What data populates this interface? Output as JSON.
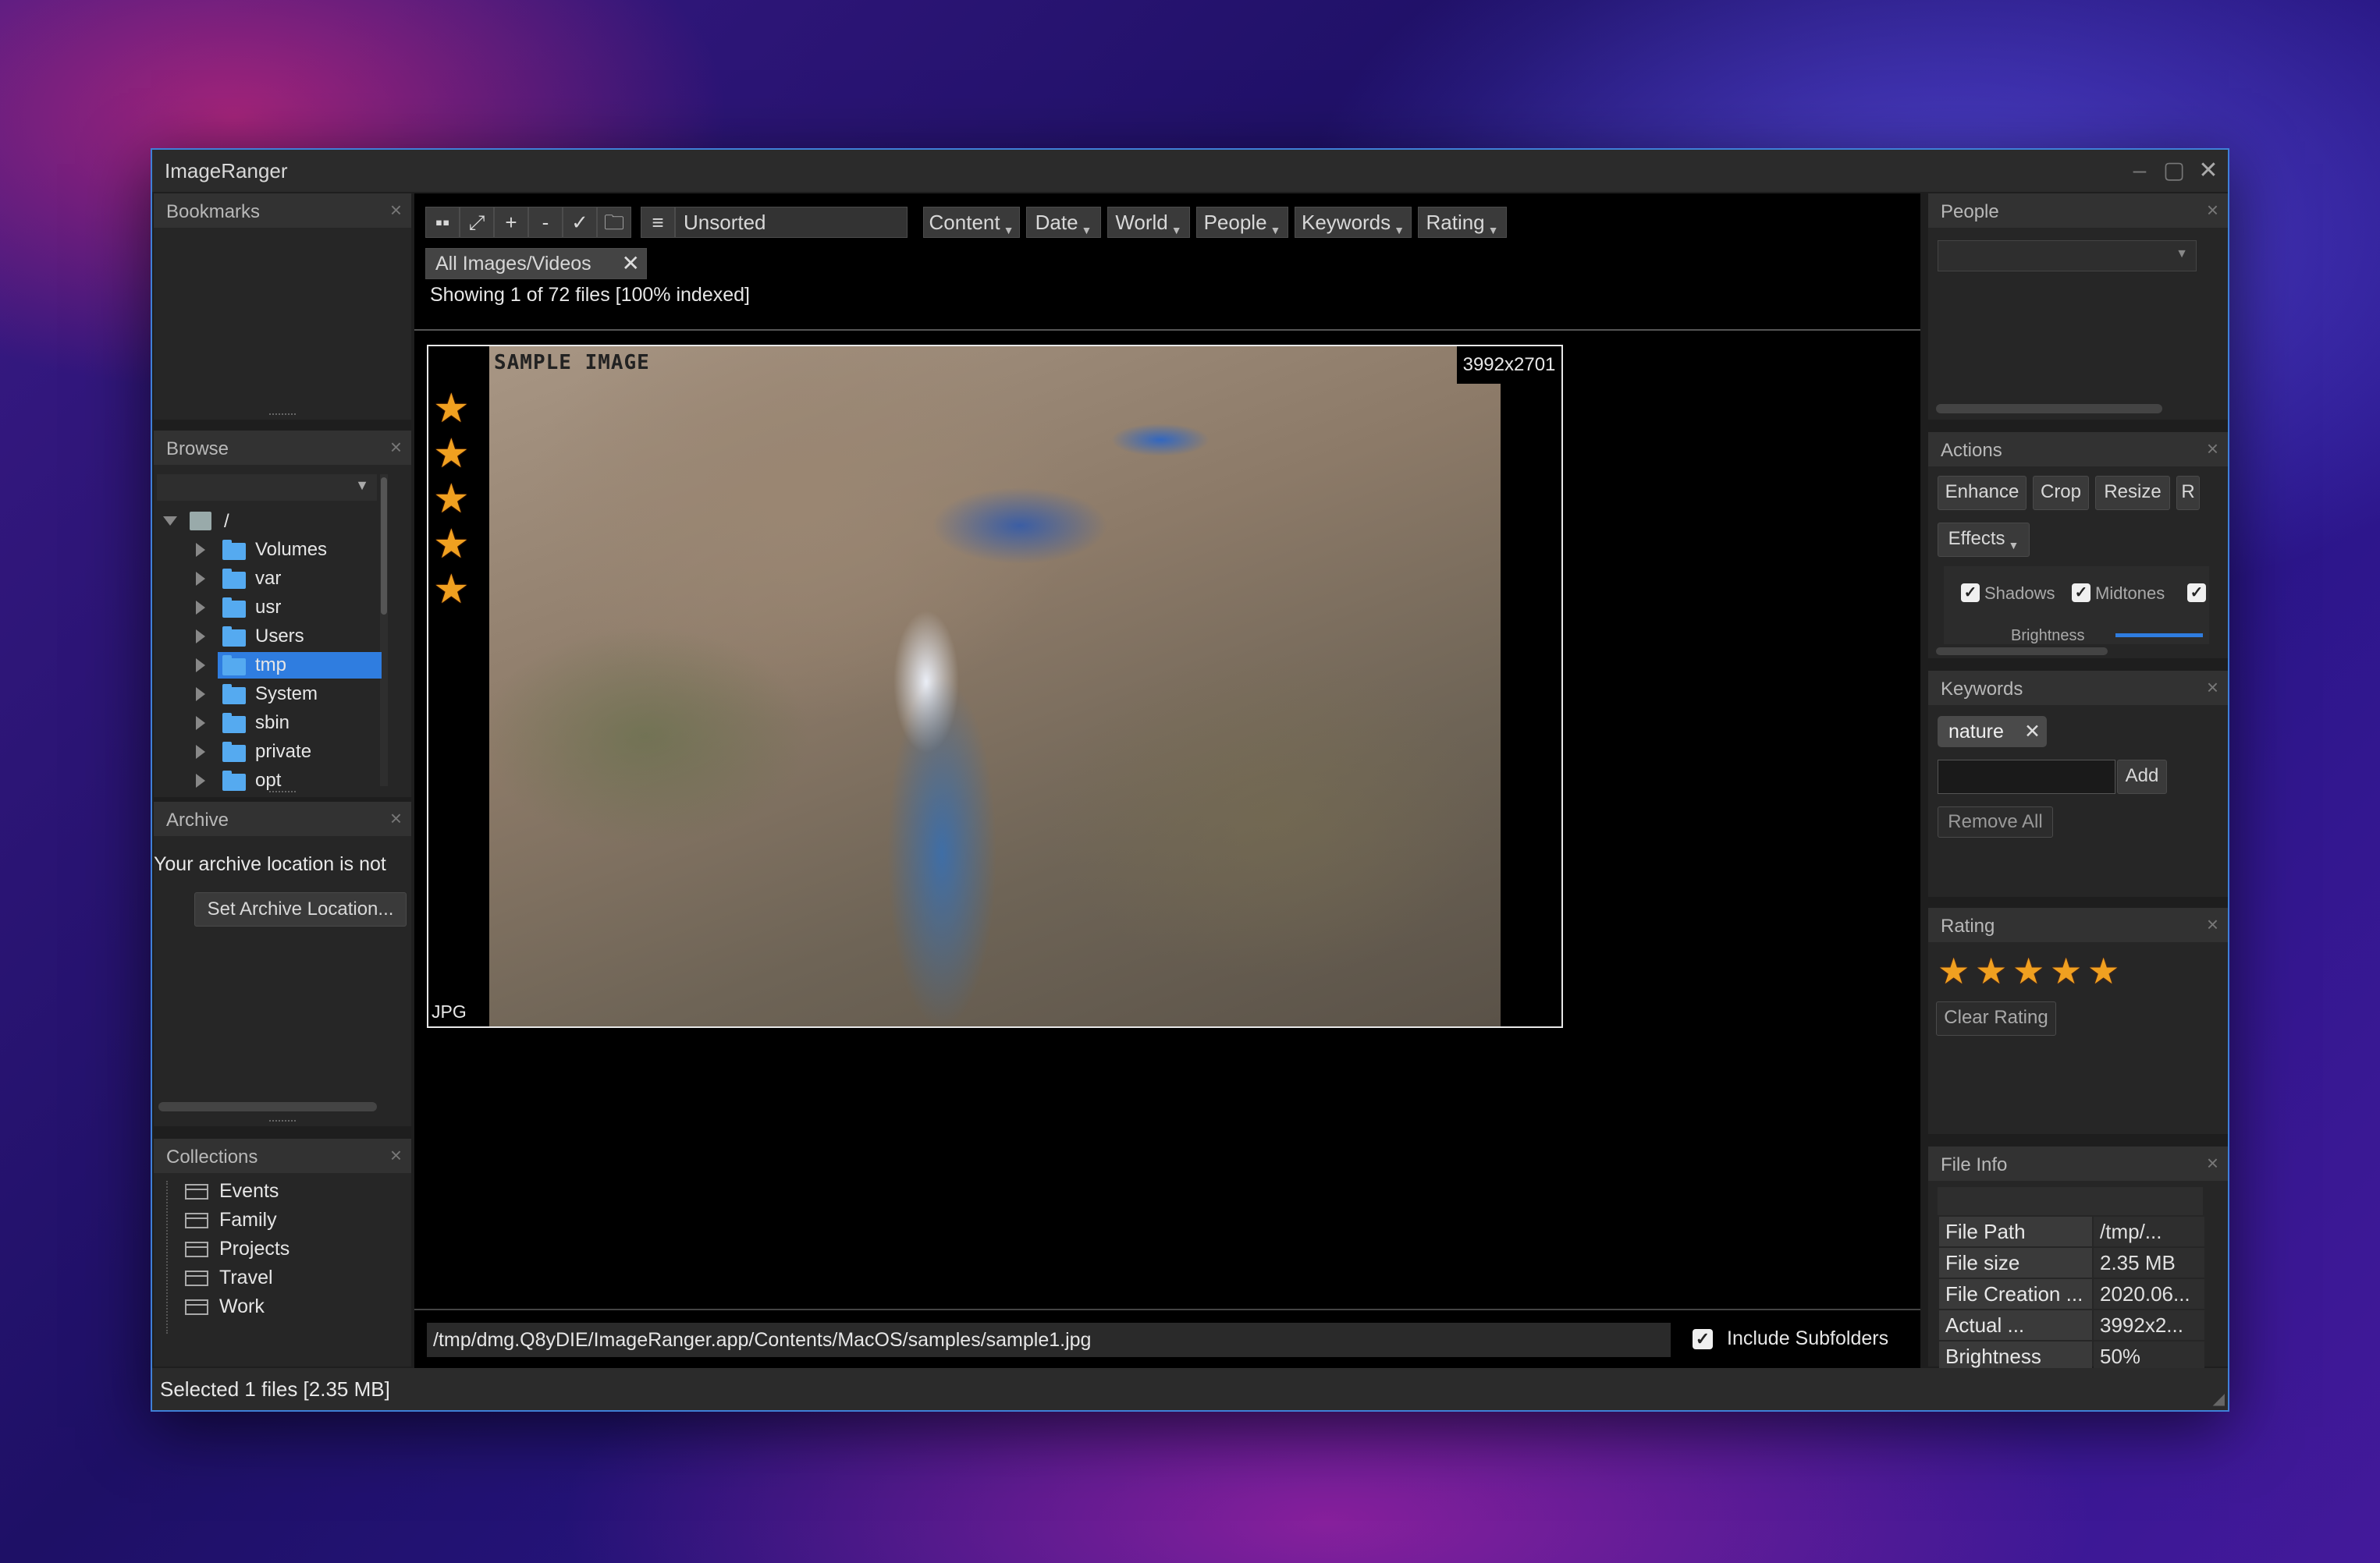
{
  "window": {
    "title": "ImageRanger",
    "controls": [
      "minimize-icon",
      "maximize-icon",
      "close-icon"
    ]
  },
  "bookmarks": {
    "title": "Bookmarks"
  },
  "browse": {
    "title": "Browse",
    "root": "/",
    "items": [
      {
        "label": "Volumes",
        "selected": false
      },
      {
        "label": "var",
        "selected": false
      },
      {
        "label": "usr",
        "selected": false
      },
      {
        "label": "Users",
        "selected": false
      },
      {
        "label": "tmp",
        "selected": true
      },
      {
        "label": "System",
        "selected": false
      },
      {
        "label": "sbin",
        "selected": false
      },
      {
        "label": "private",
        "selected": false
      },
      {
        "label": "opt",
        "selected": false
      }
    ]
  },
  "archive": {
    "title": "Archive",
    "message": "Your archive location is not",
    "button": "Set Archive Location..."
  },
  "collections": {
    "title": "Collections",
    "items": [
      "Events",
      "Family",
      "Projects",
      "Travel",
      "Work"
    ]
  },
  "toolbar": {
    "sort": "Unsorted",
    "filters": [
      "Content",
      "Date",
      "World",
      "People",
      "Keywords",
      "Rating"
    ],
    "filter_tag": "All Images/Videos",
    "status": "Showing 1 of 72 files [100% indexed]"
  },
  "thumbnail": {
    "dimensions": "3992x2701",
    "format": "JPG",
    "watermark": "SAMPLE IMAGE",
    "rating": 5
  },
  "pathbar": {
    "path": "/tmp/dmg.Q8yDIE/ImageRanger.app/Contents/MacOS/samples/sample1.jpg",
    "include_subfolders_label": "Include Subfolders",
    "include_subfolders": true
  },
  "statusbar": {
    "text": "Selected 1 files [2.35 MB]"
  },
  "people": {
    "title": "People"
  },
  "actions": {
    "title": "Actions",
    "buttons": [
      "Enhance",
      "Crop",
      "Resize",
      "R"
    ],
    "effects": "Effects",
    "checks": [
      "Shadows",
      "Midtones"
    ],
    "brightness_label": "Brightness"
  },
  "keywords": {
    "title": "Keywords",
    "tags": [
      "nature"
    ],
    "add": "Add",
    "remove_all": "Remove All"
  },
  "rating": {
    "title": "Rating",
    "stars": 5,
    "clear": "Clear Rating"
  },
  "fileinfo": {
    "title": "File Info",
    "rows": [
      {
        "key": "File Path",
        "value": "/tmp/..."
      },
      {
        "key": "File size",
        "value": "2.35 MB"
      },
      {
        "key": "File Creation ...",
        "value": "2020.06..."
      },
      {
        "key": "Actual ...",
        "value": "3992x2..."
      },
      {
        "key": "Brightness",
        "value": "50%"
      }
    ]
  },
  "colors": {
    "accent": "#3f80d8",
    "selection": "#2f7de0",
    "star": "#f0a020",
    "folder": "#55aaf0"
  }
}
